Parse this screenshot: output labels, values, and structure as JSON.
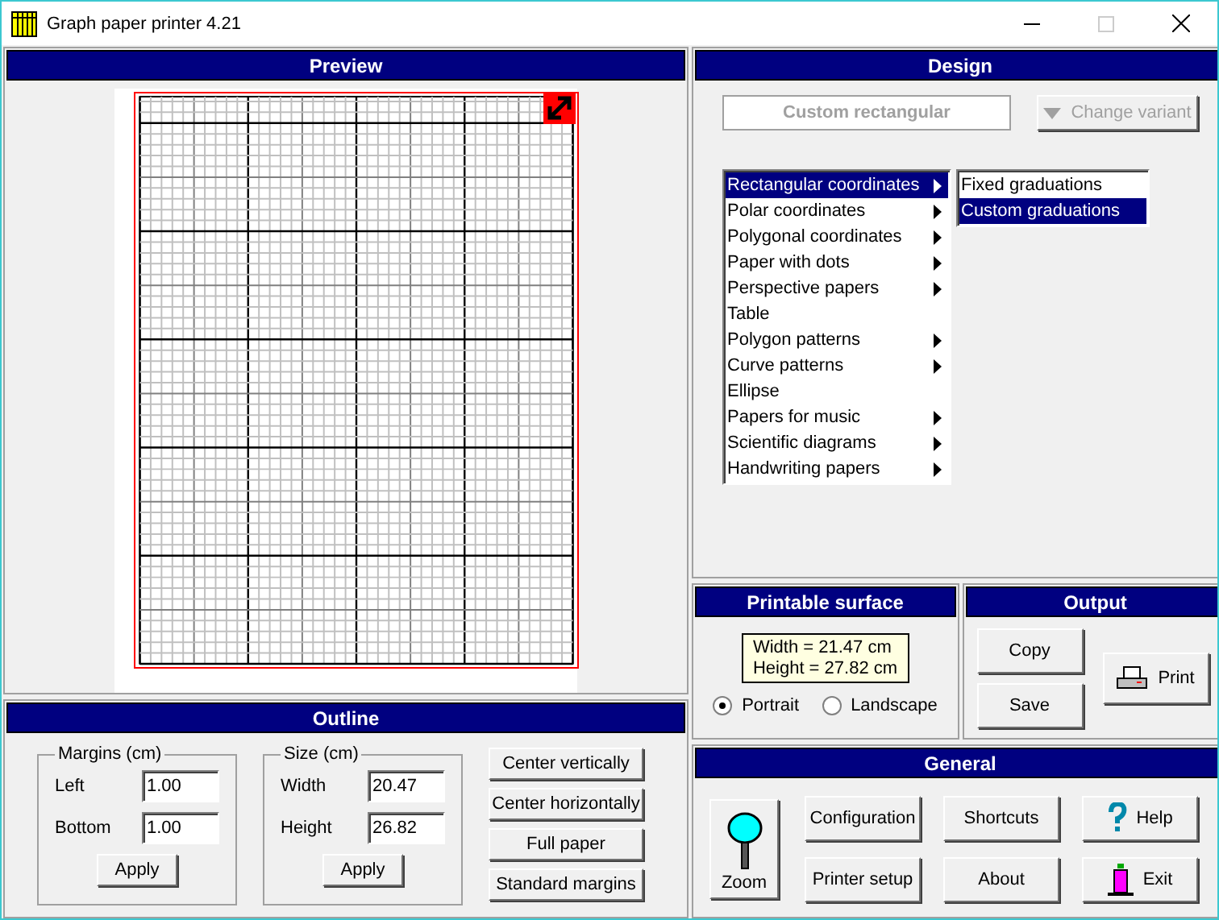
{
  "window": {
    "title": "Graph paper printer 4.21"
  },
  "preview": {
    "title": "Preview"
  },
  "design": {
    "title": "Design",
    "variant_button": {
      "label": "Custom rectangular",
      "disabled": true
    },
    "change_variant": {
      "label": "Change variant",
      "disabled": true
    },
    "categories": [
      {
        "label": "Rectangular coordinates",
        "submenu": true,
        "selected": true
      },
      {
        "label": "Polar coordinates",
        "submenu": true,
        "selected": false
      },
      {
        "label": "Polygonal coordinates",
        "submenu": true,
        "selected": false
      },
      {
        "label": "Paper with dots",
        "submenu": true,
        "selected": false
      },
      {
        "label": "Perspective papers",
        "submenu": true,
        "selected": false
      },
      {
        "label": "Table",
        "submenu": false,
        "selected": false
      },
      {
        "label": "Polygon patterns",
        "submenu": true,
        "selected": false
      },
      {
        "label": "Curve patterns",
        "submenu": true,
        "selected": false
      },
      {
        "label": "Ellipse",
        "submenu": false,
        "selected": false
      },
      {
        "label": "Papers for music",
        "submenu": true,
        "selected": false
      },
      {
        "label": "Scientific diagrams",
        "submenu": true,
        "selected": false
      },
      {
        "label": "Handwriting papers",
        "submenu": true,
        "selected": false
      }
    ],
    "variants": [
      {
        "label": "Fixed graduations",
        "selected": false
      },
      {
        "label": "Custom graduations",
        "selected": true
      }
    ]
  },
  "outline": {
    "title": "Outline",
    "groups": [
      {
        "legend": "Margins (cm)",
        "fields": [
          {
            "label": "Left",
            "value": "1.00"
          },
          {
            "label": "Bottom",
            "value": "1.00"
          }
        ],
        "apply": "Apply"
      },
      {
        "legend": "Size (cm)",
        "fields": [
          {
            "label": "Width",
            "value": "20.47"
          },
          {
            "label": "Height",
            "value": "26.82"
          }
        ],
        "apply": "Apply"
      }
    ],
    "buttons": [
      "Center vertically",
      "Center horizontally",
      "Full paper",
      "Standard margins"
    ]
  },
  "printable_surface": {
    "title": "Printable surface",
    "width": "Width = 21.47 cm",
    "height": "Height = 27.82 cm",
    "orientations": [
      {
        "label": "Portrait",
        "selected": true
      },
      {
        "label": "Landscape",
        "selected": false
      }
    ]
  },
  "output": {
    "title": "Output",
    "copy": "Copy",
    "save": "Save",
    "print": "Print"
  },
  "general": {
    "title": "General",
    "zoom": "Zoom",
    "configuration": "Configuration",
    "shortcuts": "Shortcuts",
    "help": "Help",
    "printer_setup": "Printer setup",
    "about": "About",
    "exit": "Exit"
  }
}
